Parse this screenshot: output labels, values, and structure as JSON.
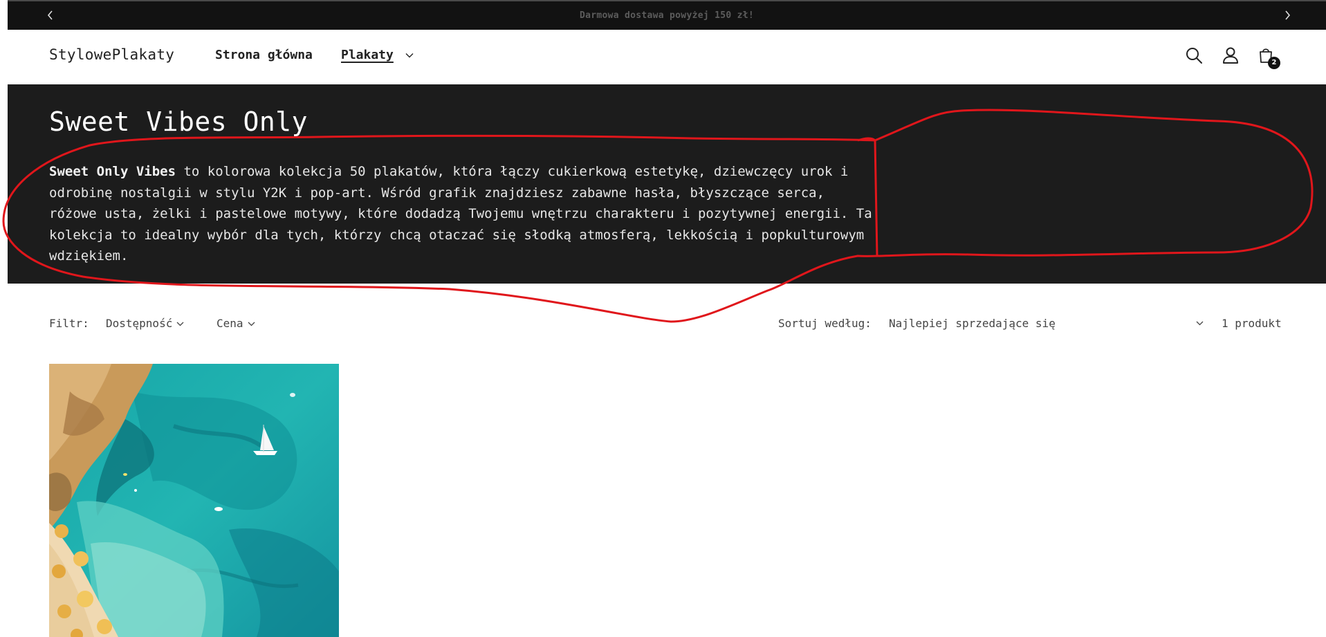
{
  "announcement": {
    "text": "Darmowa dostawa powyżej 150 zł!",
    "prev_icon": "chevron-left-icon",
    "next_icon": "chevron-right-icon"
  },
  "header": {
    "logo": "StylowePlakaty",
    "nav": [
      {
        "label": "Strona główna",
        "active": false
      },
      {
        "label": "Plakaty",
        "active": true,
        "has_dropdown": true
      }
    ],
    "icons": [
      "search-icon",
      "account-icon",
      "cart-icon"
    ],
    "cart_count": "2"
  },
  "collection": {
    "title": "Sweet Vibes Only",
    "description_bold": "Sweet Only Vibes",
    "description_rest": " to kolorowa kolekcja 50 plakatów, która łączy cukierkową estetykę, dziewczęcy urok i odrobinę nostalgii w stylu Y2K i pop-art. Wśród grafik znajdziesz zabawne hasła, błyszczące serca, różowe usta, żelki i pastelowe motywy, które dodadzą Twojemu wnętrzu charakteru i pozytywnej energii. Ta kolekcja to idealny wybór dla tych, którzy chcą otaczać się słodką atmosferą, lekkością i popkulturowym wdziękiem."
  },
  "filters": {
    "filter_label": "Filtr:",
    "availability": "Dostępność",
    "price": "Cena",
    "sort_label": "Sortuj według:",
    "sort_value": "Najlepiej sprzedające się",
    "product_count": "1 produkt"
  },
  "products": [
    {
      "image": "beach-painting-image"
    }
  ],
  "colors": {
    "announcement_bg": "#121212",
    "banner_bg": "#1c1c1c",
    "annotation_red": "#e0161b",
    "badge_bg": "#121212"
  }
}
